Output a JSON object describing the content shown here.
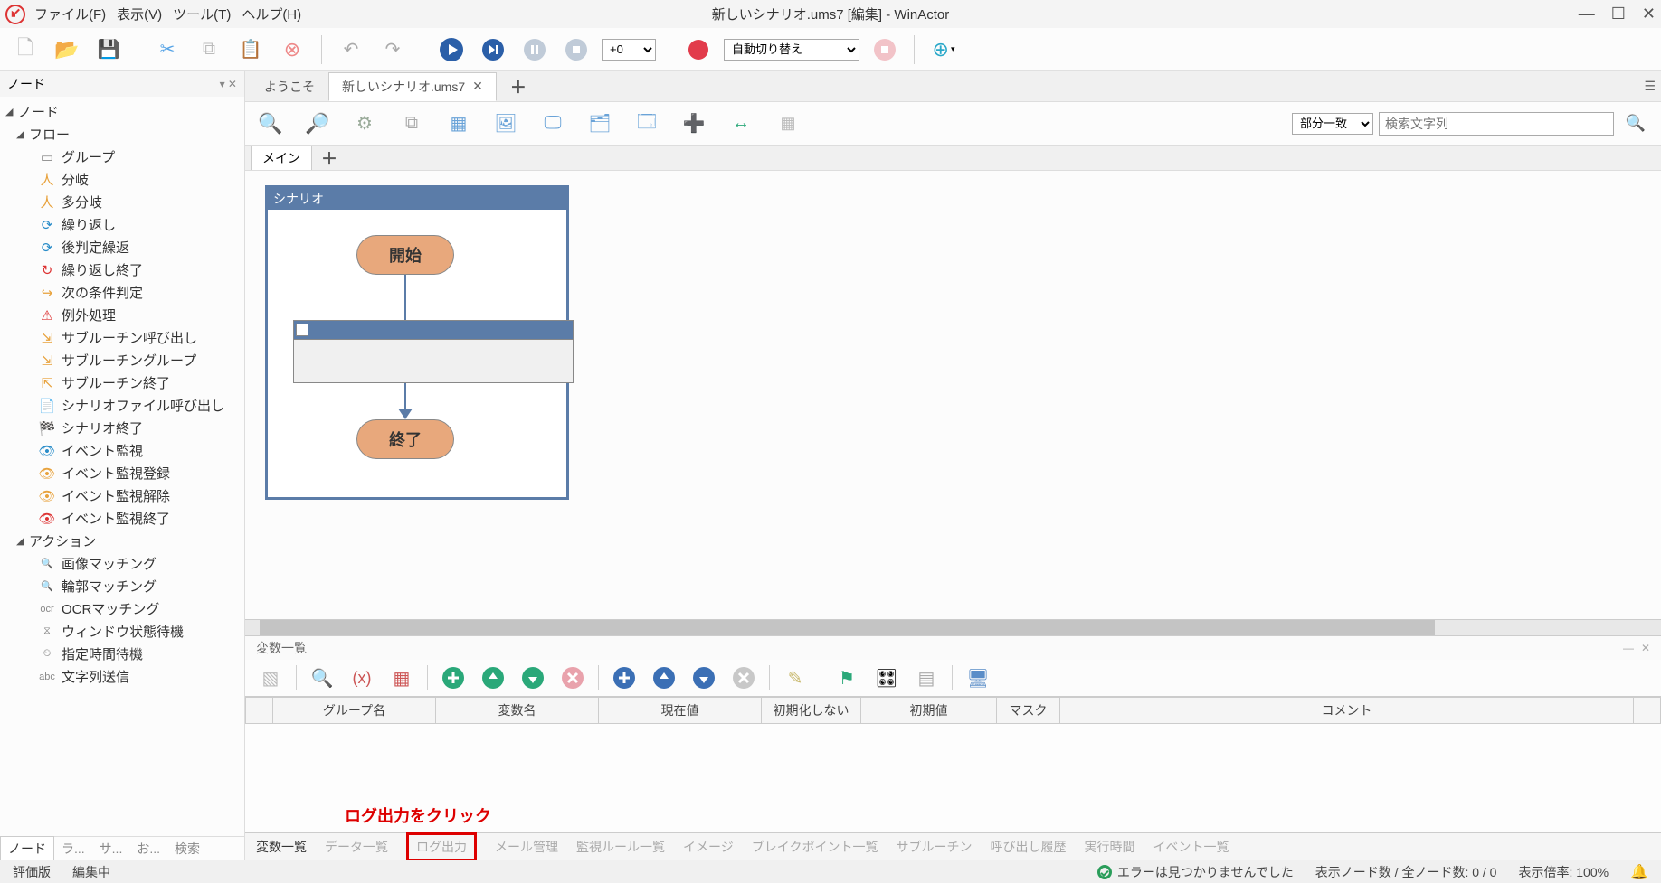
{
  "window": {
    "title": "新しいシナリオ.ums7 [編集] - WinActor"
  },
  "menu": {
    "file": "ファイル(F)",
    "view": "表示(V)",
    "tool": "ツール(T)",
    "help": "ヘルプ(H)"
  },
  "toolbar": {
    "plus0_value": "+0",
    "mode_value": "自動切り替え"
  },
  "sidePanel": {
    "title": "ノード",
    "root": "ノード",
    "groups": {
      "flow": "フロー",
      "action": "アクション"
    },
    "flowItems": [
      "グループ",
      "分岐",
      "多分岐",
      "繰り返し",
      "後判定繰返",
      "繰り返し終了",
      "次の条件判定",
      "例外処理",
      "サブルーチン呼び出し",
      "サブルーチングループ",
      "サブルーチン終了",
      "シナリオファイル呼び出し",
      "シナリオ終了",
      "イベント監視",
      "イベント監視登録",
      "イベント監視解除",
      "イベント監視終了"
    ],
    "actionItems": [
      "画像マッチング",
      "輪郭マッチング",
      "OCRマッチング",
      "ウィンドウ状態待機",
      "指定時間待機",
      "文字列送信"
    ],
    "tabs": [
      "ノード",
      "ラ...",
      "サ...",
      "お...",
      "検索"
    ]
  },
  "docTabs": {
    "welcome": "ようこそ",
    "scenario": "新しいシナリオ.ums7"
  },
  "innerToolbar": {
    "matchMode": "部分一致",
    "searchPlaceholder": "検索文字列"
  },
  "subtabs": {
    "main": "メイン"
  },
  "scenario": {
    "title": "シナリオ",
    "start": "開始",
    "end": "終了"
  },
  "varsPanel": {
    "title": "変数一覧",
    "cols": [
      "",
      "グループ名",
      "変数名",
      "現在値",
      "初期化しない",
      "初期値",
      "マスク",
      "コメント",
      ""
    ]
  },
  "annotation": "ログ出力をクリック",
  "bottomTabs": [
    "変数一覧",
    "データ一覧",
    "ログ出力",
    "メール管理",
    "監視ルール一覧",
    "イメージ",
    "ブレイクポイント一覧",
    "サブルーチン",
    "呼び出し履歴",
    "実行時間",
    "イベント一覧"
  ],
  "status": {
    "eval": "評価版",
    "editing": "編集中",
    "noError": "エラーは見つかりませんでした",
    "nodeCount": "表示ノード数 / 全ノード数: 0 / 0",
    "zoom": "表示倍率: 100%"
  }
}
